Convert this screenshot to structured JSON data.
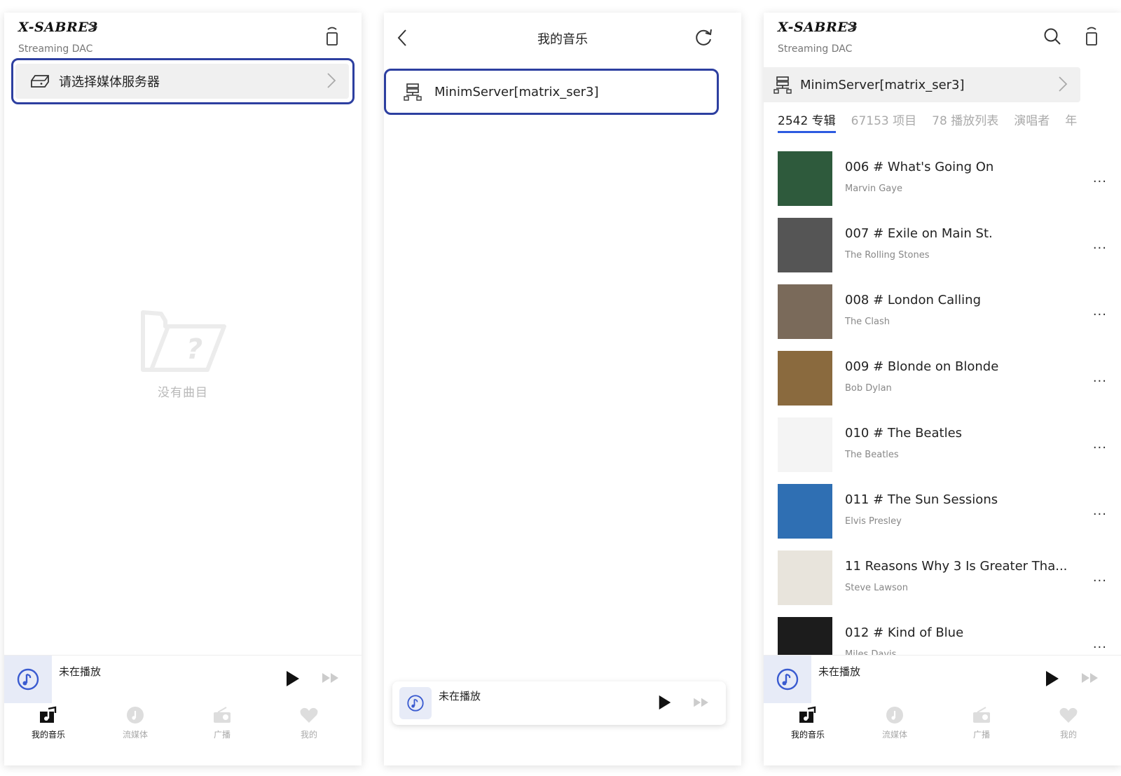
{
  "brand": {
    "name": "X-SABRE3",
    "subtitle": "Streaming DAC",
    "arrow": ">"
  },
  "screen1": {
    "server_label": "请选择媒体服务器",
    "empty_text": "没有曲目"
  },
  "screen2": {
    "title": "我的音乐",
    "server_name": "MinimServer[matrix_ser3]"
  },
  "screen3": {
    "server_name": "MinimServer[matrix_ser3]",
    "tabs": [
      {
        "label": "2542 专辑"
      },
      {
        "label": "67153 项目"
      },
      {
        "label": "78 播放列表"
      },
      {
        "label": "演唱者"
      },
      {
        "label": "年"
      }
    ],
    "albums": [
      {
        "title": "006 # What's Going On",
        "artist": "Marvin Gaye",
        "cover_color": "#2e5a3c"
      },
      {
        "title": "007 # Exile on Main St.",
        "artist": "The Rolling Stones",
        "cover_color": "#555555"
      },
      {
        "title": "008 # London Calling",
        "artist": "The Clash",
        "cover_color": "#7a6a5a"
      },
      {
        "title": "009 # Blonde on Blonde",
        "artist": "Bob Dylan",
        "cover_color": "#8a6a3e"
      },
      {
        "title": "010 # The Beatles",
        "artist": "The Beatles",
        "cover_color": "#f4f4f4"
      },
      {
        "title": "011 # The Sun Sessions",
        "artist": "Elvis Presley",
        "cover_color": "#2f6fb3"
      },
      {
        "title": "11 Reasons Why 3 Is Greater Tha...",
        "artist": "Steve Lawson",
        "cover_color": "#e8e4dc"
      },
      {
        "title": "012 # Kind of Blue",
        "artist": "Miles Davis",
        "cover_color": "#1c1c1c"
      }
    ],
    "more_glyph": "..."
  },
  "mini_player": {
    "status": "未在播放"
  },
  "tabbar": {
    "my_music": "我的音乐",
    "streaming": "流媒体",
    "radio": "广播",
    "mine": "我的"
  },
  "colors": {
    "accent": "#2d3fa0",
    "tab_underline": "#2d5be0",
    "mini_art_bg": "#e7ebf7"
  }
}
